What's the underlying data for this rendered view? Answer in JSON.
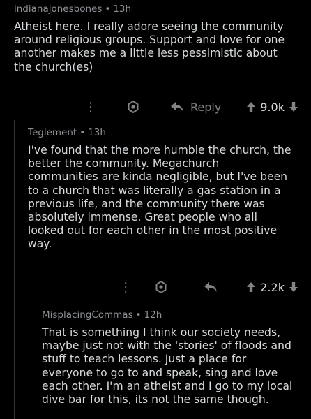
{
  "comments": [
    {
      "author": "indianajonesbones",
      "age": "13h",
      "lines": [
        "Atheist here. I really adore seeing the community",
        "around religious groups. Support and love for one",
        "another makes me a little less pessimistic about",
        "the church(es)"
      ],
      "reply_label": "Reply",
      "score": "9.0k"
    },
    {
      "author": "Teglement",
      "age": "13h",
      "lines": [
        "I've found that the more humble the church, the",
        "better the community.  Megachurch",
        "communities are kinda negligible, but I've been",
        "to a church that was literally a gas station in a",
        "previous life, and the community there was",
        "absolutely immense.  Great people who all",
        "looked out for each other in the most positive",
        "way."
      ],
      "score": "2.2k"
    },
    {
      "author": "MisplacingCommas",
      "age": "12h",
      "lines": [
        "That is something I think our society needs,",
        "maybe just not with the 'stories' of floods and",
        "stuff to teach lessons. Just a place for",
        "everyone to go to and speak, sing and love",
        "each other. I'm an atheist and I go to my local",
        "dive bar for this, its not the same though."
      ]
    }
  ],
  "separator": "•",
  "icons": {
    "more": "more-options-icon",
    "award": "award-icon",
    "reply": "reply-arrow-icon",
    "upvote": "upvote-arrow-icon",
    "downvote": "downvote-arrow-icon"
  }
}
